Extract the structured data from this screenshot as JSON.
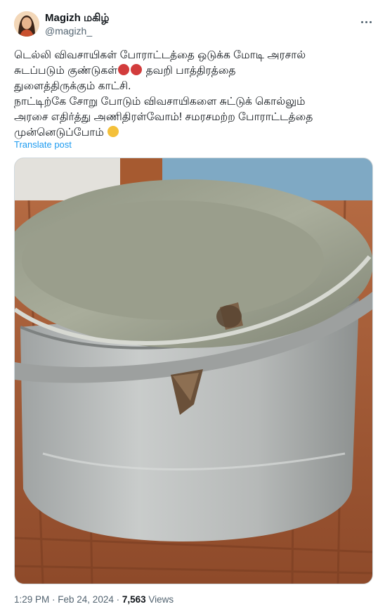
{
  "author": {
    "display_name": "Magizh மகிழ்",
    "handle": "@magizh_"
  },
  "tweet": {
    "line1": "டெல்லி விவசாயிகள் போராட்டத்தை ஒடுக்க மோடி அரசால்",
    "line2a": "சுடப்படும் குண்டுகள்",
    "line2b": " தவறி பாத்திரத்தை",
    "line3": "துளைத்திருக்கும் காட்சி.",
    "line4": "நாட்டிற்கே சோறு போடும் விவசாயிகளை சுட்டுக் கொல்லும்",
    "line5": "அரசை எதிர்த்து அணிதிரள்வோம்! சமரசமற்ற போராட்டத்தை",
    "line6": "முன்னெடுப்போம்",
    "emoji_angry": "angry-face-icon",
    "emoji_fist": "raised-fist-icon"
  },
  "translate_label": "Translate post",
  "media": {
    "description_icon": "photo-image"
  },
  "meta": {
    "time": "1:29 PM",
    "separator": " · ",
    "date": "Feb 24, 2024",
    "views_count": "7,563",
    "views_label": " Views"
  },
  "colors": {
    "link": "#1d9bf0",
    "secondary_text": "#536471",
    "primary_text": "#0f1419"
  }
}
